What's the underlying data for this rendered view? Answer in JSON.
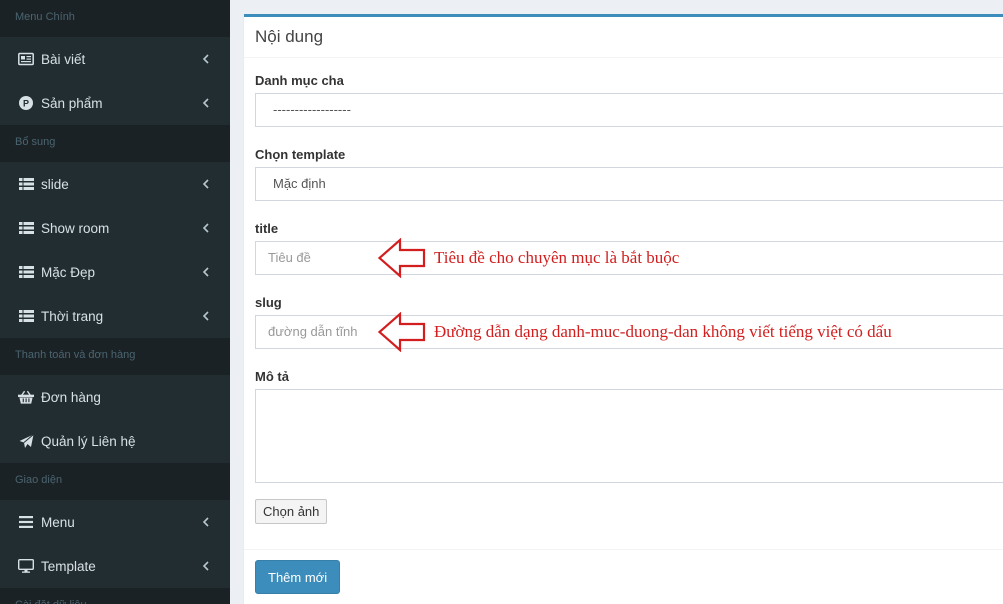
{
  "sidebar": {
    "sections": [
      {
        "header": "Menu Chính",
        "items": [
          {
            "label": "Bài viết",
            "icon": "newspaper-icon",
            "chevron": true
          },
          {
            "label": "Sản phẩm",
            "icon": "product-circle-icon",
            "chevron": true
          }
        ]
      },
      {
        "header": "Bổ sung",
        "items": [
          {
            "label": "slide",
            "icon": "list-icon",
            "chevron": true
          },
          {
            "label": "Show room",
            "icon": "list-icon",
            "chevron": true
          },
          {
            "label": "Mặc Đẹp",
            "icon": "list-icon",
            "chevron": true
          },
          {
            "label": "Thời trang",
            "icon": "list-icon",
            "chevron": true
          }
        ]
      },
      {
        "header": "Thanh toán và đơn hàng",
        "items": [
          {
            "label": "Đơn hàng",
            "icon": "basket-icon",
            "chevron": false
          },
          {
            "label": "Quản lý Liên hệ",
            "icon": "paper-plane-icon",
            "chevron": false
          }
        ]
      },
      {
        "header": "Giao diện",
        "items": [
          {
            "label": "Menu",
            "icon": "bars-icon",
            "chevron": true
          },
          {
            "label": "Template",
            "icon": "desktop-icon",
            "chevron": true
          }
        ]
      },
      {
        "header": "Cài đặt dữ liệu",
        "items": []
      }
    ]
  },
  "form": {
    "box_title": "Nội dung",
    "parent_category": {
      "label": "Danh mục cha",
      "value": "------------------"
    },
    "template": {
      "label": "Chọn template",
      "value": "Mặc định"
    },
    "title": {
      "label": "title",
      "placeholder": "Tiêu đề"
    },
    "slug": {
      "label": "slug",
      "placeholder": "đường dẫn tĩnh"
    },
    "description": {
      "label": "Mô tả"
    },
    "choose_image_button": "Chọn ảnh",
    "submit_button": "Thêm mới"
  },
  "annotations": {
    "title_note": "Tiêu đề cho chuyên mục là bắt buộc",
    "slug_note": "Đường dẫn dạng danh-muc-duong-dan không viết tiếng việt có dấu"
  },
  "colors": {
    "sidebar_bg": "#222d32",
    "sidebar_header_bg": "#1a2226",
    "accent": "#3c8dbc",
    "annotation_red": "#d21e1e"
  }
}
